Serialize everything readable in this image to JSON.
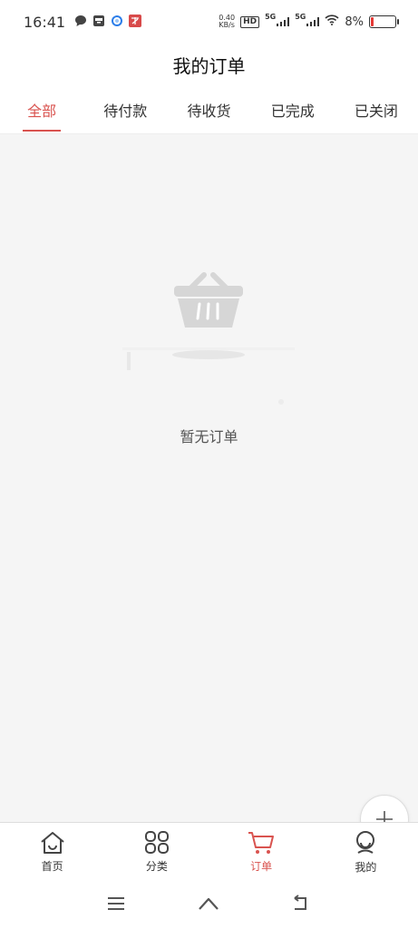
{
  "status_bar": {
    "time": "16:41",
    "net_speed_value": "0.40",
    "net_speed_unit": "KB/s",
    "hd_label": "HD",
    "sig1_label": "5G",
    "sig2_label": "5G",
    "battery_pct": "8%"
  },
  "header": {
    "title": "我的订单"
  },
  "tabs": [
    {
      "label": "全部",
      "active": true
    },
    {
      "label": "待付款",
      "active": false
    },
    {
      "label": "待收货",
      "active": false
    },
    {
      "label": "已完成",
      "active": false
    },
    {
      "label": "已关闭",
      "active": false
    }
  ],
  "empty_state": {
    "text": "暂无订单",
    "icon": "basket-icon"
  },
  "fab": {
    "icon": "plus-icon"
  },
  "bottom_nav": [
    {
      "label": "首页",
      "icon": "home-icon",
      "active": false
    },
    {
      "label": "分类",
      "icon": "grid-icon",
      "active": false
    },
    {
      "label": "订单",
      "icon": "cart-icon",
      "active": true
    },
    {
      "label": "我的",
      "icon": "user-icon",
      "active": false
    }
  ],
  "colors": {
    "accent": "#d9534f",
    "background": "#f5f5f5"
  }
}
